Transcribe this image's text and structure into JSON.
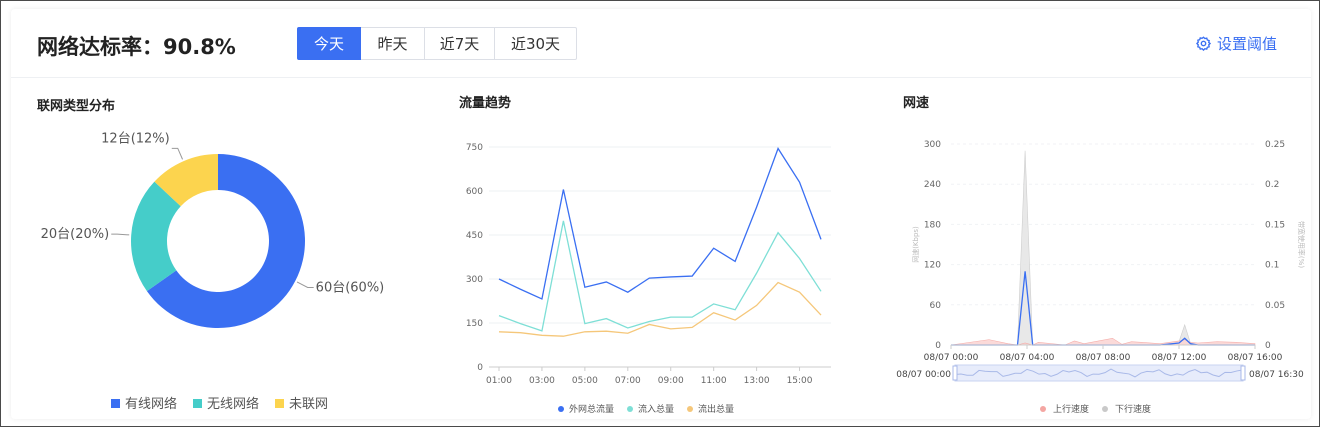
{
  "header": {
    "title": "网络达标率：90.8%",
    "tabs": [
      {
        "label": "今天",
        "active": true
      },
      {
        "label": "昨天",
        "active": false
      },
      {
        "label": "近7天",
        "active": false
      },
      {
        "label": "近30天",
        "active": false
      }
    ],
    "settings_label": "设置阈值"
  },
  "colors": {
    "accent": "#3a6ff2",
    "wired": "#3a6ff2",
    "wireless": "#45cdc9",
    "offline": "#fcd44e",
    "upload": "#f4a6a2",
    "download": "#c9c9c9"
  },
  "panels": {
    "donut_title": "联网类型分布",
    "traffic_title": "流量趋势",
    "speed_title": "网速"
  },
  "chart_data": [
    {
      "type": "pie",
      "title": "联网类型分布",
      "slices": [
        {
          "name": "有线网络",
          "value": 60,
          "label": "60台(60%)",
          "color": "#3a6ff2"
        },
        {
          "name": "无线网络",
          "value": 20,
          "label": "20台(20%)",
          "color": "#45cdc9"
        },
        {
          "name": "未联网",
          "value": 12,
          "label": "12台(12%)",
          "color": "#fcd44e"
        }
      ],
      "legend_position": "bottom"
    },
    {
      "type": "line",
      "title": "流量趋势",
      "x": [
        "01:00",
        "02:00",
        "03:00",
        "04:00",
        "05:00",
        "06:00",
        "07:00",
        "08:00",
        "09:00",
        "10:00",
        "11:00",
        "12:00",
        "13:00",
        "14:00",
        "15:00",
        "16:00"
      ],
      "x_tick_labels": [
        "01:00",
        "03:00",
        "05:00",
        "07:00",
        "09:00",
        "11:00",
        "13:00",
        "15:00"
      ],
      "ylim": [
        0,
        750
      ],
      "y_ticks": [
        0,
        150,
        300,
        450,
        600,
        750
      ],
      "series": [
        {
          "name": "外网总流量",
          "color": "#3a6ff2",
          "values": [
            300,
            265,
            232,
            605,
            272,
            290,
            255,
            303,
            307,
            310,
            405,
            360,
            545,
            745,
            630,
            435
          ]
        },
        {
          "name": "流入总量",
          "color": "#7edfd6",
          "values": [
            175,
            148,
            123,
            498,
            148,
            165,
            133,
            155,
            170,
            170,
            215,
            195,
            320,
            458,
            370,
            258
          ]
        },
        {
          "name": "流出总量",
          "color": "#f5c77a",
          "values": [
            120,
            117,
            108,
            105,
            120,
            122,
            115,
            145,
            130,
            135,
            185,
            160,
            210,
            288,
            255,
            177
          ]
        }
      ],
      "grid": true,
      "legend_position": "bottom"
    },
    {
      "type": "area",
      "title": "网速",
      "x_tick_labels": [
        "08/07 00:00",
        "08/07 04:00",
        "08/07 08:00",
        "08/07 12:00",
        "08/07 16:00"
      ],
      "x_hours": [
        0,
        2,
        3,
        3.5,
        3.9,
        4.3,
        4.6,
        6,
        6.5,
        7,
        8.5,
        9,
        9.5,
        10,
        11,
        12,
        12.3,
        12.6,
        13,
        14,
        15,
        16
      ],
      "ylim_left": [
        0,
        300
      ],
      "y_ticks_left": [
        0,
        60,
        120,
        180,
        240,
        300
      ],
      "ylim_right": [
        0,
        0.25
      ],
      "y_ticks_right": [
        "0",
        "0.05",
        "0.1",
        "0.15",
        "0.2",
        "0.25"
      ],
      "ylabel_left": "网速(Kbps)",
      "ylabel_right": "带宽使用率(%)",
      "series": [
        {
          "name": "上行速度",
          "color": "#f4a6a2",
          "values": [
            0,
            8,
            2,
            0,
            3,
            0,
            4,
            0,
            6,
            2,
            10,
            1,
            5,
            4,
            2,
            6,
            8,
            4,
            3,
            5,
            4,
            2
          ]
        },
        {
          "name": "下行速度",
          "color": "#c9c9c9",
          "values": [
            0,
            0,
            0,
            0,
            290,
            0,
            0,
            0,
            0,
            0,
            0,
            0,
            0,
            0,
            0,
            5,
            30,
            3,
            0,
            2,
            0,
            0
          ]
        },
        {
          "name": "网速",
          "color": "#3a6ff2",
          "values": [
            0,
            0,
            0,
            0,
            110,
            0,
            0,
            0,
            0,
            0,
            0,
            0,
            0,
            0,
            0,
            3,
            10,
            2,
            0,
            0,
            0,
            0
          ]
        }
      ],
      "zoom_start_label": "08/07 00:00",
      "zoom_end_label": "08/07 16:30",
      "legend_position": "bottom"
    }
  ]
}
